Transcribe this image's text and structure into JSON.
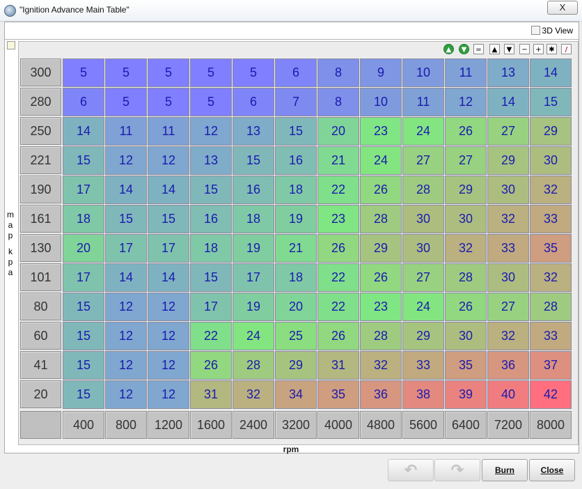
{
  "window": {
    "title": "\"Ignition Advance Main Table\"",
    "close_glyph": "X"
  },
  "toolbar": {
    "view3d_label": "3D View",
    "buttons": [
      {
        "name": "increment-green-icon",
        "glyph": "▲"
      },
      {
        "name": "decrement-green-icon",
        "glyph": "▼"
      },
      {
        "name": "set-equal-button",
        "glyph": "="
      },
      {
        "name": "shift-up-button",
        "glyph": "▲"
      },
      {
        "name": "shift-down-button",
        "glyph": "▼"
      },
      {
        "name": "minus-button",
        "glyph": "−"
      },
      {
        "name": "plus-button",
        "glyph": "+"
      },
      {
        "name": "multiply-button",
        "glyph": "✱"
      },
      {
        "name": "pen-button",
        "glyph": "/"
      }
    ]
  },
  "table": {
    "y_axis_label": "map kpa",
    "x_axis_label": "rpm",
    "rows": [
      "300",
      "280",
      "250",
      "221",
      "190",
      "161",
      "130",
      "101",
      "80",
      "60",
      "41",
      "20"
    ],
    "cols": [
      "400",
      "800",
      "1200",
      "1600",
      "2400",
      "3200",
      "4000",
      "4800",
      "5600",
      "6400",
      "7200",
      "8000"
    ],
    "values": [
      [
        5,
        5,
        5,
        5,
        5,
        6,
        8,
        9,
        10,
        11,
        13,
        14
      ],
      [
        6,
        5,
        5,
        5,
        6,
        7,
        8,
        10,
        11,
        12,
        14,
        15
      ],
      [
        14,
        11,
        11,
        12,
        13,
        15,
        20,
        23,
        24,
        26,
        27,
        29
      ],
      [
        15,
        12,
        12,
        13,
        15,
        16,
        21,
        24,
        27,
        27,
        29,
        30
      ],
      [
        17,
        14,
        14,
        15,
        16,
        18,
        22,
        26,
        28,
        29,
        30,
        32
      ],
      [
        18,
        15,
        15,
        16,
        18,
        19,
        23,
        28,
        30,
        30,
        32,
        33
      ],
      [
        20,
        17,
        17,
        18,
        19,
        21,
        26,
        29,
        30,
        32,
        33,
        35
      ],
      [
        17,
        14,
        14,
        15,
        17,
        18,
        22,
        26,
        27,
        28,
        30,
        32
      ],
      [
        15,
        12,
        12,
        17,
        19,
        20,
        22,
        23,
        24,
        26,
        27,
        28
      ],
      [
        15,
        12,
        12,
        22,
        24,
        25,
        26,
        28,
        29,
        30,
        32,
        33
      ],
      [
        15,
        12,
        12,
        26,
        28,
        29,
        31,
        32,
        33,
        35,
        36,
        37
      ],
      [
        15,
        12,
        12,
        31,
        32,
        34,
        35,
        36,
        38,
        39,
        40,
        42
      ]
    ]
  },
  "buttons": {
    "undo_glyph": "↶",
    "redo_glyph": "↷",
    "burn_label": "Burn",
    "close_label": "Close"
  },
  "colors": {
    "low": "#7f7fff",
    "mid": "#80e880",
    "high": "#ff6f7f"
  }
}
